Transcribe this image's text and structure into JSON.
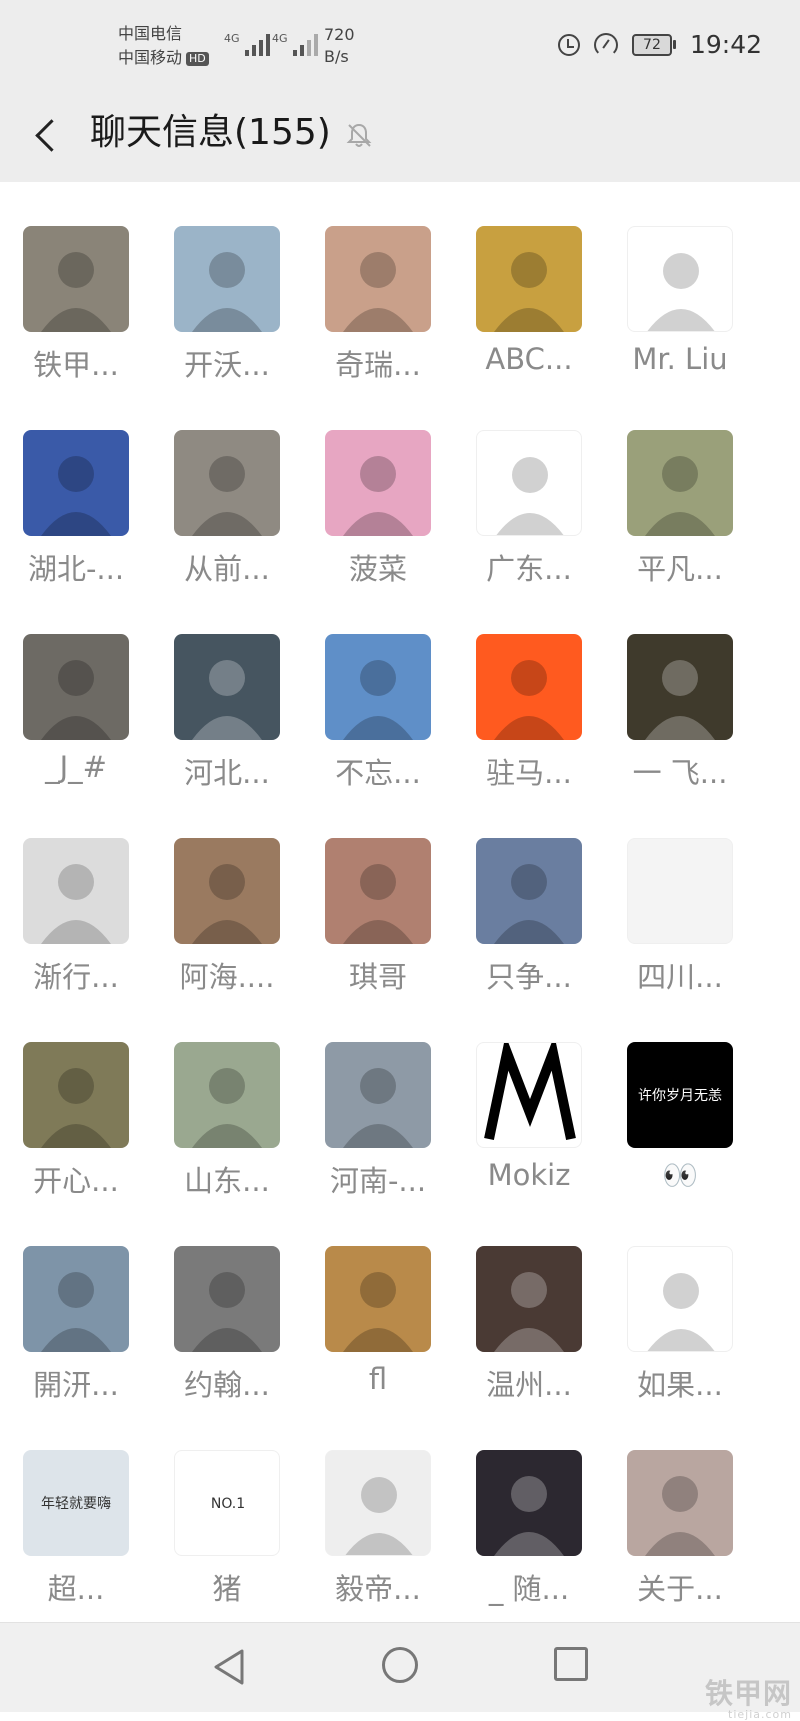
{
  "status_bar": {
    "carrier_1": "中国电信",
    "carrier_2": "中国移动",
    "hd_badge": "HD",
    "net_label_1": "4G",
    "net_label_2": "4G",
    "net_speed_value": "720",
    "net_speed_unit": "B/s",
    "battery_level": "72",
    "time": "19:42"
  },
  "header": {
    "title": "聊天信息(155)",
    "icons": {
      "back": "back-arrow-icon",
      "mute": "bell-muted-icon"
    }
  },
  "members": [
    {
      "name": "铁甲...",
      "avatar_color": "#8a8478"
    },
    {
      "name": "开沃...",
      "avatar_color": "#9bb4c8"
    },
    {
      "name": "奇瑞...",
      "avatar_color": "#c9a08a"
    },
    {
      "name": "ABC...",
      "avatar_color": "#c8a040"
    },
    {
      "name": "Mr. Liu",
      "avatar_color": "#ffffff"
    },
    {
      "name": "湖北-...",
      "avatar_color": "#3a5aa8"
    },
    {
      "name": "从前...",
      "avatar_color": "#8f8a82"
    },
    {
      "name": "菠菜",
      "avatar_color": "#e7a6c2"
    },
    {
      "name": "广东...",
      "avatar_color": "#ffffff"
    },
    {
      "name": "平凡...",
      "avatar_color": "#9aa07a"
    },
    {
      "name": "_J_#",
      "avatar_color": "#6d6a64"
    },
    {
      "name": "河北...",
      "avatar_color": "#465560"
    },
    {
      "name": "不忘...",
      "avatar_color": "#5f8fc8"
    },
    {
      "name": "驻马...",
      "avatar_color": "#ff5a1f"
    },
    {
      "name": "一 飞...",
      "avatar_color": "#3f3a2c"
    },
    {
      "name": "渐行...",
      "avatar_color": "#dcdcdc"
    },
    {
      "name": "阿海....",
      "avatar_color": "#9a7a60"
    },
    {
      "name": "琪哥",
      "avatar_color": "#b08070"
    },
    {
      "name": "只争...",
      "avatar_color": "#6a7ea0"
    },
    {
      "name": "四川...",
      "avatar_color": "#f4f4f4"
    },
    {
      "name": "开心...",
      "avatar_color": "#7f7a58"
    },
    {
      "name": "山东...",
      "avatar_color": "#9aa890"
    },
    {
      "name": "河南-...",
      "avatar_color": "#8e9aa6"
    },
    {
      "name": "Mokiz",
      "avatar_color": "#ffffff"
    },
    {
      "name": "👀",
      "avatar_color": "#000000",
      "avatar_text": "许你岁月无恙"
    },
    {
      "name": "開汧...",
      "avatar_color": "#7e94a8"
    },
    {
      "name": "约翰...",
      "avatar_color": "#7a7a7a"
    },
    {
      "name": "fl",
      "avatar_color": "#b98a4a"
    },
    {
      "name": "温州...",
      "avatar_color": "#4a3a34"
    },
    {
      "name": "如果...",
      "avatar_color": "#ffffff"
    },
    {
      "name": "超...",
      "avatar_color": "#dde4ea",
      "avatar_text": "年轻就要嗨"
    },
    {
      "name": "猪",
      "avatar_color": "#ffffff",
      "avatar_text": "NO.1"
    },
    {
      "name": "毅帝...",
      "avatar_color": "#eeeeee"
    },
    {
      "name": "_ 随...",
      "avatar_color": "#2c2830"
    },
    {
      "name": "关于...",
      "avatar_color": "#b9a6a0"
    }
  ],
  "nav_bar": {
    "icons": [
      "triangle-back-icon",
      "circle-home-icon",
      "square-recents-icon"
    ]
  },
  "watermark": {
    "text": "铁甲网",
    "sub": "tiejia.com"
  }
}
